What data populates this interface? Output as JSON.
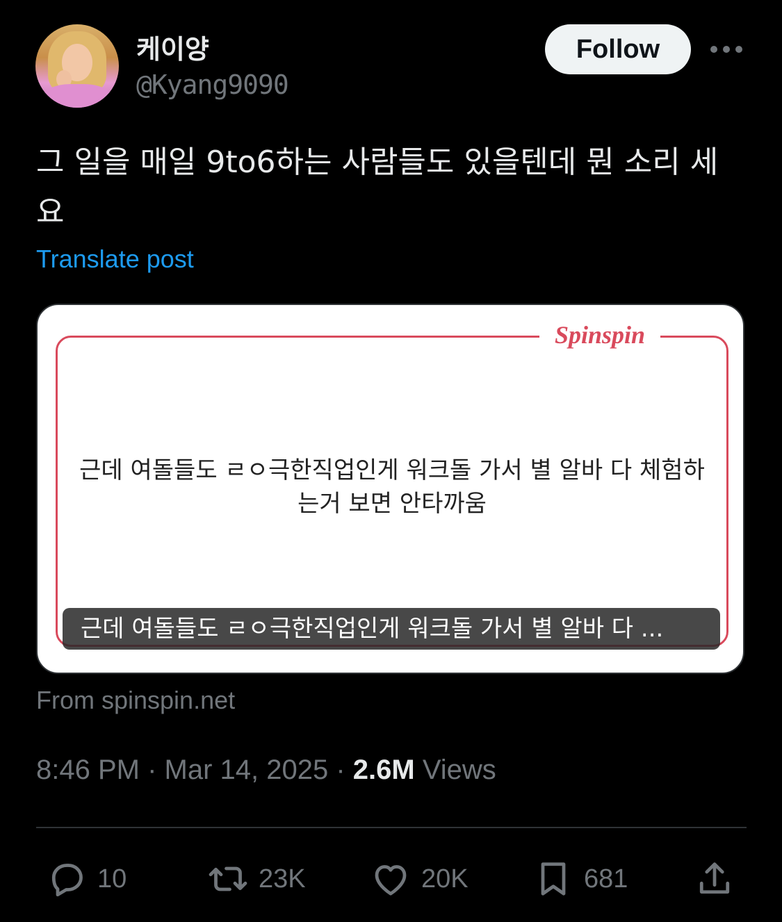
{
  "author": {
    "display_name": "케이양",
    "handle": "@Kyang9090",
    "avatar_icon": "profile-photo"
  },
  "follow_label": "Follow",
  "post": {
    "text": "그 일을 매일 9to6하는 사람들도 있을텐데 뭔 소리 세요",
    "translate_label": "Translate post"
  },
  "card": {
    "logo": "Spinspin",
    "quote": "근데 여돌들도 ㄹㅇ극한직업인게 워크돌 가서 별 알바 다 체험하는거 보면 안타까움",
    "caption": "근데 여돌들도 ㄹㅇ극한직업인게 워크돌 가서 별 알바 다 ...",
    "source": "From spinspin.net",
    "accent_color": "#d94a5c"
  },
  "meta": {
    "time": "8:46 PM",
    "separator": " · ",
    "date": "Mar 14, 2025",
    "views_count": "2.6M",
    "views_label": "Views"
  },
  "actions": {
    "replies": "10",
    "reposts": "23K",
    "likes": "20K",
    "bookmarks": "681"
  },
  "colors": {
    "background": "#000000",
    "text": "#e7e9ea",
    "secondary": "#71767b",
    "link": "#1d9bf0"
  }
}
